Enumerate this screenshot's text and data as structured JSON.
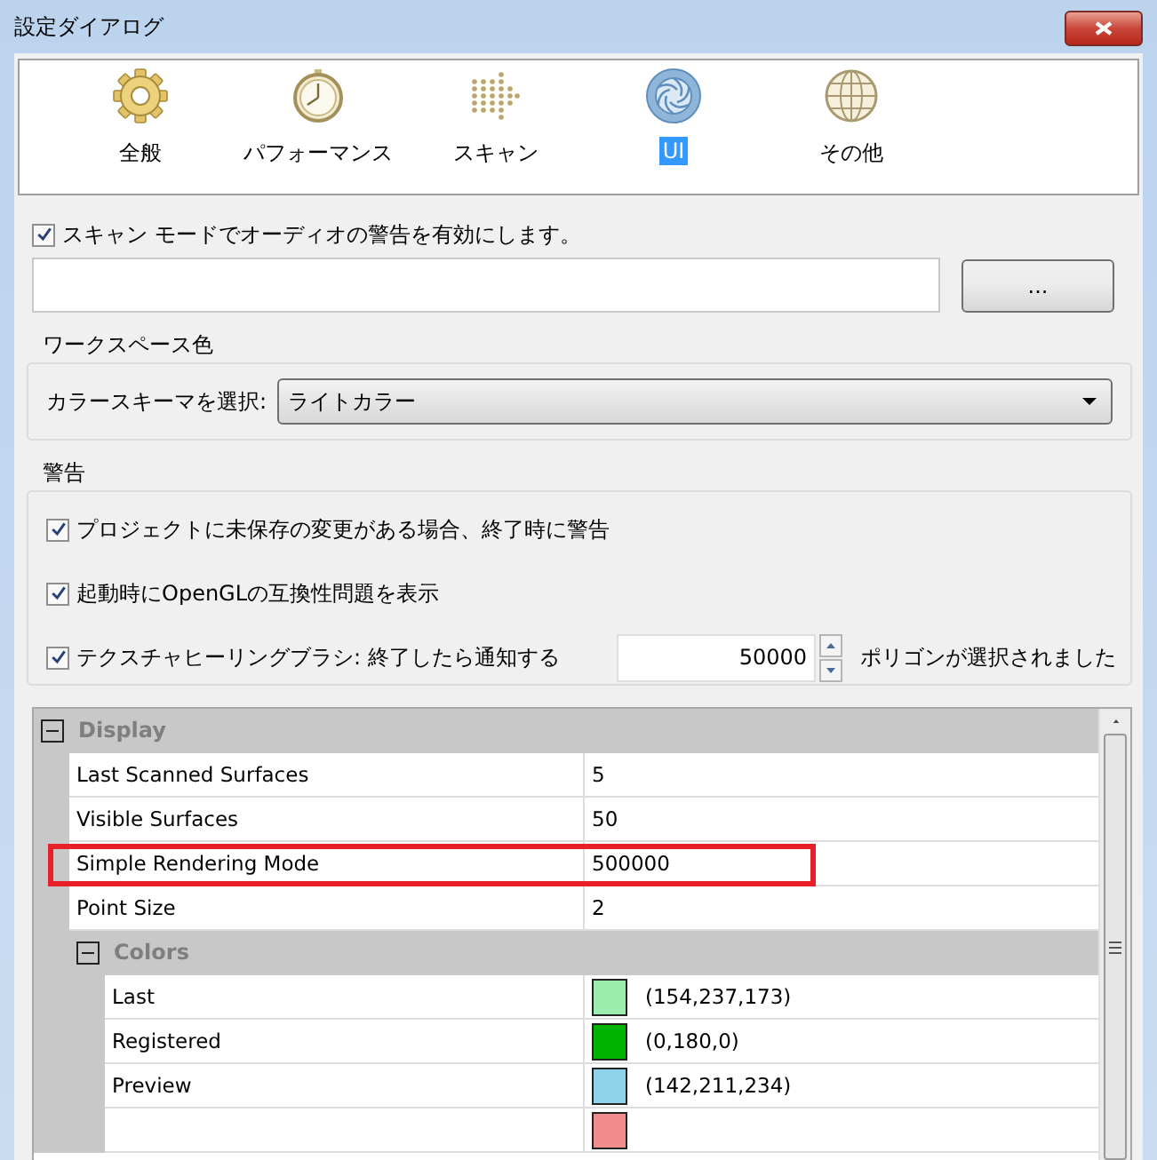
{
  "window": {
    "title": "設定ダイアログ"
  },
  "categories": [
    {
      "label": "全般",
      "kind": "gear",
      "selected": false
    },
    {
      "label": "パフォーマンス",
      "kind": "stopwatch",
      "selected": false
    },
    {
      "label": "スキャン",
      "kind": "dots",
      "selected": false
    },
    {
      "label": "UI",
      "kind": "aperture",
      "selected": true
    },
    {
      "label": "その他",
      "kind": "globe",
      "selected": false
    }
  ],
  "audio_warning": {
    "label": "スキャン モードでオーディオの警告を有効にします。",
    "checked": true
  },
  "path_field": {
    "browse_button": "..."
  },
  "workspace_color": {
    "title": "ワークスペース色",
    "label": "カラースキーマを選択:",
    "value": "ライトカラー"
  },
  "warnings": {
    "title": "警告",
    "items": [
      {
        "kind": "check",
        "label": "プロジェクトに未保存の変更がある場合、終了時に警告",
        "checked": true
      },
      {
        "kind": "check",
        "label": "起動時にOpenGLの互換性問題を表示",
        "checked": true
      },
      {
        "kind": "spin",
        "label": "テクスチャヒーリングブラシ: 終了したら通知する",
        "checked": true,
        "value": "50000",
        "suffix": "ポリゴンが選択されました"
      }
    ]
  },
  "property_grid": [
    {
      "kind": "group",
      "label": "Display",
      "expanded": true,
      "children": [
        {
          "kind": "prop",
          "label": "Last Scanned Surfaces",
          "value": "5",
          "highlighted": false
        },
        {
          "kind": "prop",
          "label": "Visible Surfaces",
          "value": "50",
          "highlighted": false
        },
        {
          "kind": "prop",
          "label": "Simple Rendering Mode",
          "value": "500000",
          "highlighted": true
        },
        {
          "kind": "prop",
          "label": "Point Size",
          "value": "2",
          "highlighted": false
        },
        {
          "kind": "group",
          "label": "Colors",
          "expanded": true,
          "children": [
            {
              "kind": "color",
              "label": "Last",
              "value": "(154,237,173)",
              "color": "#9aedad"
            },
            {
              "kind": "color",
              "label": "Registered",
              "value": "(0,180,0)",
              "color": "#00b400"
            },
            {
              "kind": "color",
              "label": "Preview",
              "value": "(142,211,234)",
              "color": "#8ed3ea"
            },
            {
              "kind": "color",
              "color": "#f08c8c"
            }
          ]
        }
      ]
    }
  ]
}
